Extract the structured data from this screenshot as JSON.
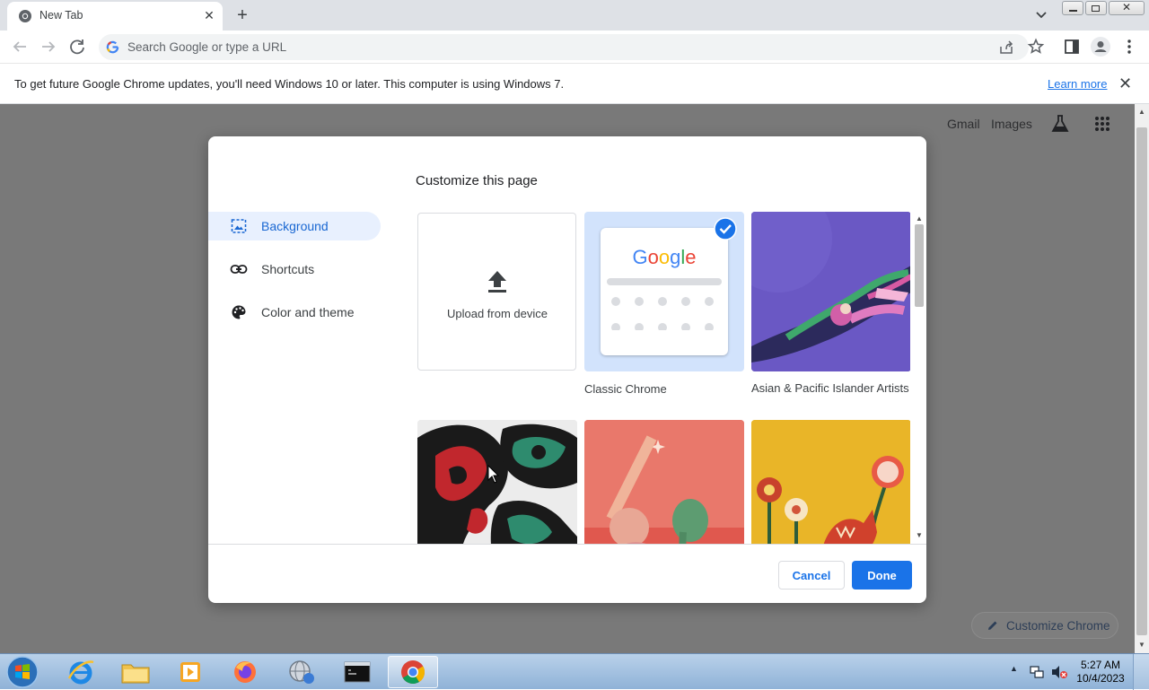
{
  "tab": {
    "title": "New Tab"
  },
  "omnibox": {
    "placeholder": "Search Google or type a URL"
  },
  "infobar": {
    "message": "To get future Google Chrome updates, you'll need Windows 10 or later. This computer is using Windows 7.",
    "link": "Learn more"
  },
  "ntp": {
    "gmail": "Gmail",
    "images": "Images",
    "customize_chrome": "Customize Chrome"
  },
  "dialog": {
    "title": "Customize this page",
    "menu": [
      {
        "label": "Background",
        "icon": "image-icon",
        "active": true
      },
      {
        "label": "Shortcuts",
        "icon": "link-icon",
        "active": false
      },
      {
        "label": "Color and theme",
        "icon": "palette-icon",
        "active": false
      }
    ],
    "upload_label": "Upload from device",
    "tiles": [
      {
        "label": "Classic Chrome",
        "selected": true
      },
      {
        "label": "Asian & Pacific Islander Artists",
        "selected": false
      }
    ],
    "classic_logo": "Google",
    "cancel": "Cancel",
    "done": "Done"
  },
  "taskbar": {
    "time": "5:27 AM",
    "date": "10/4/2023"
  },
  "colors": {
    "accent": "#1a73e8",
    "selected_bg": "#e8f0fe",
    "dim_overlay": "#797979"
  }
}
